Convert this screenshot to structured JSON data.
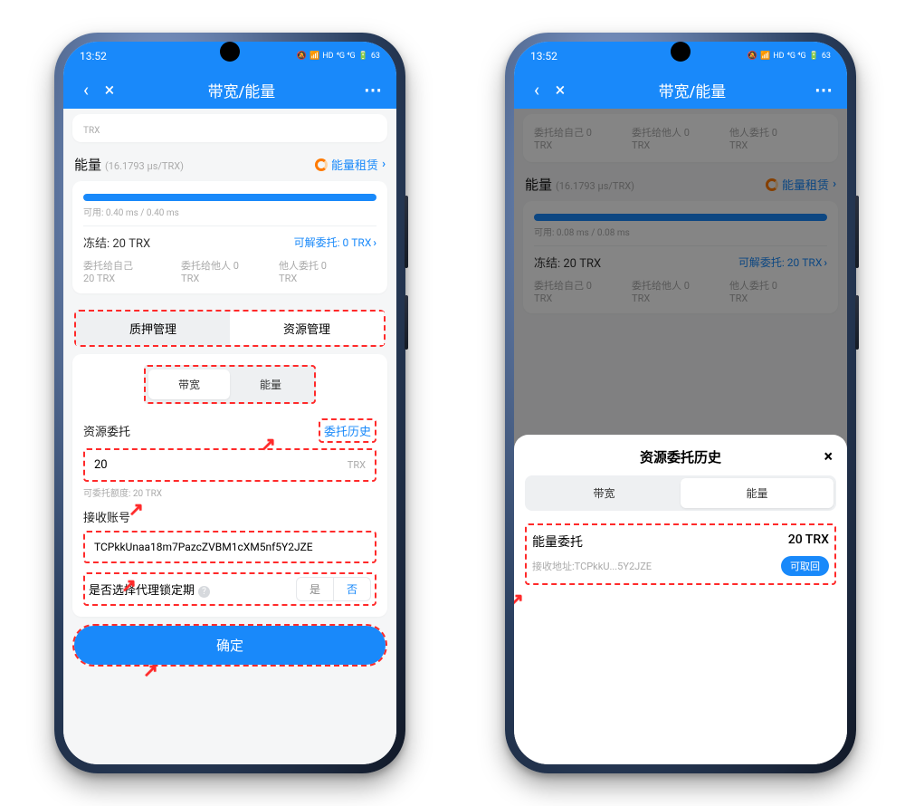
{
  "status": {
    "time": "13:52",
    "battery": "63"
  },
  "nav": {
    "title": "带宽/能量"
  },
  "left": {
    "trx_chip": "TRX",
    "energy": {
      "label": "能量",
      "rate": "(16.1793 μs/TRX)",
      "lease_link": "能量租赁",
      "available": "可用: 0.40 ms / 0.40 ms"
    },
    "frozen": {
      "label": "冻结: 20 TRX",
      "unstake": "可解委托: 0 TRX"
    },
    "cols": {
      "c1l": "委托给自己",
      "c1v": "20 TRX",
      "c2l": "委托给他人 0",
      "c2v": "TRX",
      "c3l": "他人委托 0",
      "c3v": "TRX"
    },
    "mgmt": {
      "a": "质押管理",
      "b": "资源管理"
    },
    "res_tabs": {
      "a": "带宽",
      "b": "能量"
    },
    "delegate": {
      "label": "资源委托",
      "history": "委托历史",
      "amount": "20",
      "unit": "TRX",
      "quota": "可委托额度: 20 TRX"
    },
    "receiver": {
      "label": "接收账号",
      "value": "TCPkkUnaa18m7PazcZVBM1cXM5nf5Y2JZE"
    },
    "lock": {
      "label": "是否选择代理锁定期",
      "yes": "是",
      "no": "否"
    },
    "confirm": "确定"
  },
  "right": {
    "head": {
      "c1l": "委托给自己 0",
      "c1v": "TRX",
      "c2l": "委托给他人 0",
      "c2v": "TRX",
      "c3l": "他人委托 0",
      "c3v": "TRX"
    },
    "energy": {
      "label": "能量",
      "rate": "(16.1793 μs/TRX)",
      "lease_link": "能量租赁",
      "available": "可用: 0.08 ms / 0.08 ms"
    },
    "frozen": {
      "label": "冻结: 20 TRX",
      "unstake": "可解委托: 20 TRX"
    },
    "cols": {
      "c1l": "委托给自己 0",
      "c1v": "TRX",
      "c2l": "委托给他人 0",
      "c2v": "TRX",
      "c3l": "他人委托 0",
      "c3v": "TRX"
    },
    "sheet": {
      "title": "资源委托历史",
      "tabs": {
        "a": "带宽",
        "b": "能量"
      }
    },
    "history": {
      "label": "能量委托",
      "amount": "20 TRX",
      "addr": "接收地址:TCPkkU...5Y2JZE",
      "recall": "可取回"
    }
  }
}
